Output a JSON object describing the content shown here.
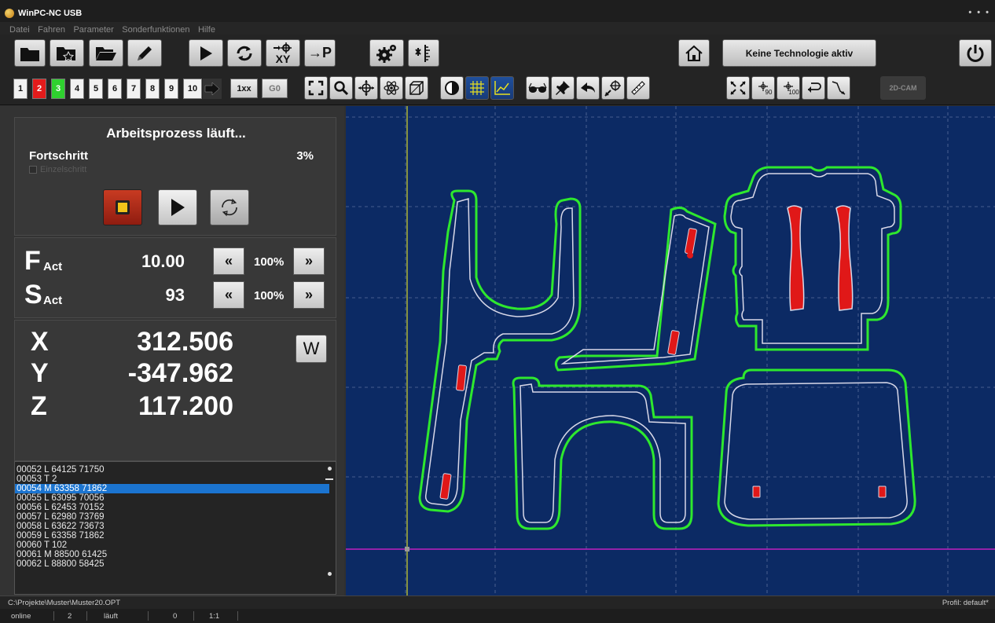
{
  "window": {
    "title": "WinPC-NC USB",
    "controls": "• • •"
  },
  "menu": [
    "Datei",
    "Fahren",
    "Parameter",
    "Sonderfunktionen",
    "Hilfe"
  ],
  "toolbar": {
    "technology_label": "Keine Technologie aktiv",
    "to_p_label": "→P",
    "xy_label": "XY"
  },
  "toolbar2": {
    "slots": [
      "1",
      "2",
      "3",
      "4",
      "5",
      "6",
      "7",
      "8",
      "9",
      "10"
    ],
    "btn_1xx": "1xx",
    "btn_g0": "G0",
    "btn_90": "90",
    "btn_100": "100",
    "btn_2dcam": "2D-CAM"
  },
  "process": {
    "title": "Arbeitsprozess läuft...",
    "progress_label": "Fortschritt",
    "progress_value": "3%",
    "progress_fraction": 0.03,
    "single_step_label": "Einzelschritt"
  },
  "feed": {
    "f_letter": "F",
    "f_sub": "Act",
    "f_value": "10.00",
    "f_pct": "100%",
    "s_letter": "S",
    "s_sub": "Act",
    "s_value": "93",
    "s_pct": "100%",
    "dec_glyph": "«",
    "inc_glyph": "»"
  },
  "axes": {
    "x_name": "X",
    "x_value": "312.506",
    "y_name": "Y",
    "y_value": "-347.962",
    "z_name": "Z",
    "z_value": "117.200",
    "w_label": "W"
  },
  "program": {
    "lines": [
      "00052  L 64125 71750",
      "00053  T 2",
      "00054  M 63358 71862",
      "00055  L 63095 70056",
      "00056  L 62453 70152",
      "00057  L 62980 73769",
      "00058  L 63622 73673",
      "00059  L 63358 71862",
      "00060  T 102",
      "00061  M 88500 61425",
      "00062  L 88800 58425"
    ],
    "selected_index": 2
  },
  "status": {
    "path": "C:\\Projekte\\Muster\\Muster20.OPT",
    "profile": "Profil: default*",
    "online": "online",
    "count": "2",
    "state": "läuft",
    "zero": "0",
    "ratio": "1:1"
  },
  "colors": {
    "canvas_bg": "#0c2a64",
    "outer_contour": "#2ee82e",
    "inner_contour": "#d8d8e8",
    "pocket": "#e01818",
    "marker": "#e01818",
    "crosshair_v": "#d6d62a",
    "crosshair_h": "#c020c0",
    "selected_line": "#1b74d0"
  }
}
